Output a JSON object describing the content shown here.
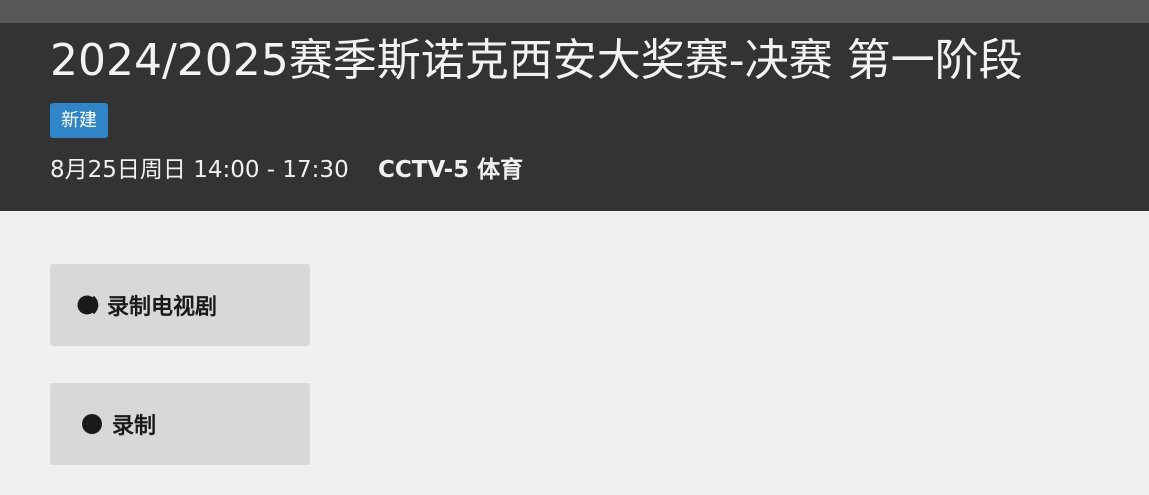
{
  "program": {
    "title": "2024/2025赛季斯诺克西安大奖赛-决赛 第一阶段",
    "badge": "新建",
    "datetime": "8月25日周日 14:00 - 17:30",
    "channel": "CCTV-5 体育"
  },
  "actions": {
    "record_series_label": "录制电视剧",
    "record_series_icon": "series-record-icon",
    "record_label": "录制",
    "record_icon": "record-dot-icon"
  },
  "colors": {
    "header_bg": "#333333",
    "topbar_bg": "#575757",
    "badge_bg": "#2e86c8",
    "page_bg": "#f0f0f0",
    "button_bg": "#d8d8d8"
  }
}
